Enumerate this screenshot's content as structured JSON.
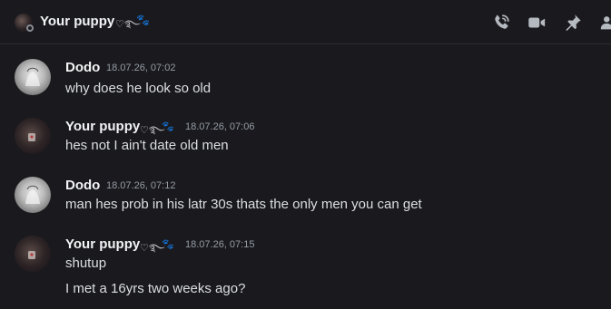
{
  "header": {
    "title": "Your puppy",
    "decor": "♡࿐",
    "paw": "🐾",
    "icons": [
      "phone-call-icon",
      "video-call-icon",
      "pin-icon",
      "members-icon"
    ]
  },
  "messages": [
    {
      "author": "Dodo",
      "timestamp": "18.07.26, 07:02",
      "lines": [
        "why does he look so old"
      ]
    },
    {
      "author": "Your puppy",
      "decor": "♡࿐",
      "paw": "🐾",
      "timestamp": "18.07.26, 07:06",
      "lines": [
        "hes not I ain't date old men"
      ]
    },
    {
      "author": "Dodo",
      "timestamp": "18.07.26, 07:12",
      "lines": [
        "man hes prob in his latr 30s thats the only men you can get"
      ]
    },
    {
      "author": "Your puppy",
      "decor": "♡࿐",
      "paw": "🐾",
      "timestamp": "18.07.26, 07:15",
      "lines": [
        "shutup",
        "I met a 16yrs two weeks ago?"
      ]
    }
  ],
  "colors": {
    "background": "#1a1a1e",
    "text": "#dbdee1",
    "username": "#f2f3f5",
    "timestamp": "#949ba4",
    "icons": "#b5bac1"
  }
}
